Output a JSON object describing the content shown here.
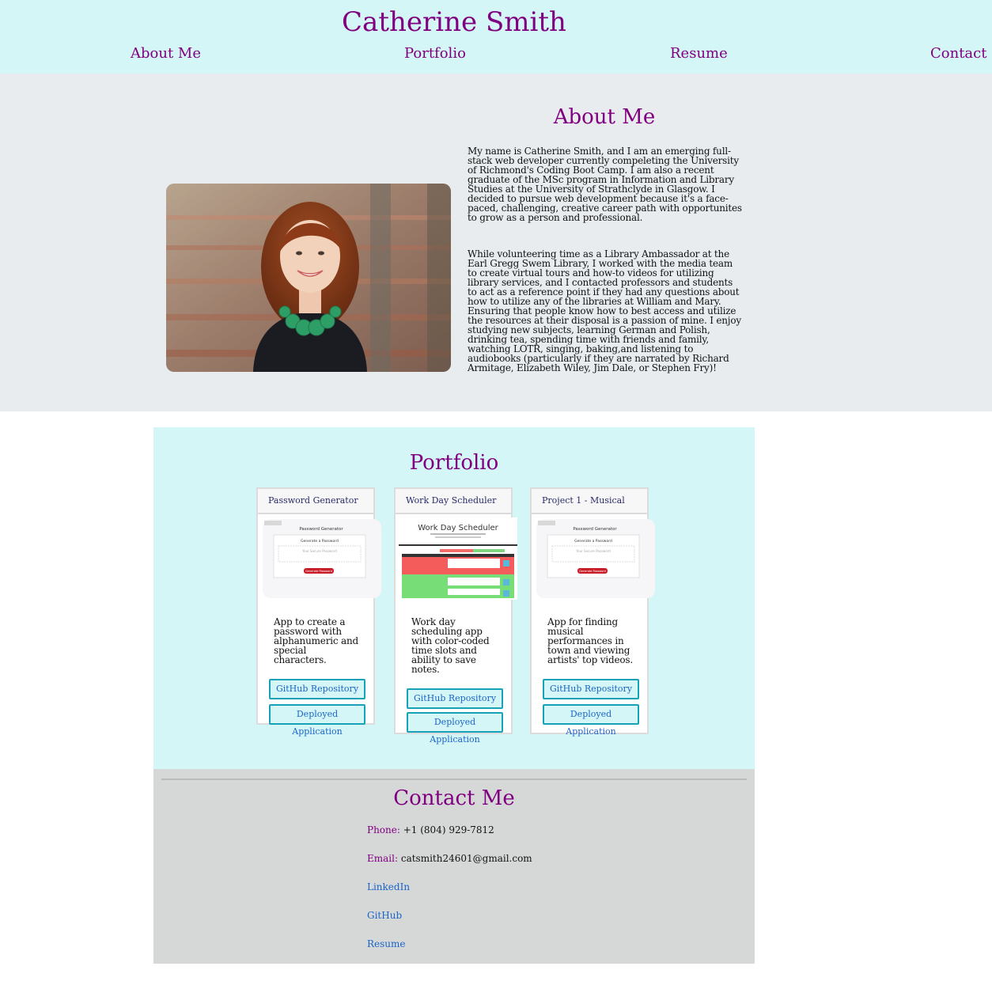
{
  "header": {
    "title": "Catherine Smith",
    "nav": [
      "About Me",
      "Portfolio",
      "Resume",
      "Contact"
    ]
  },
  "about": {
    "title": "About Me",
    "paragraphs": [
      "My name is Catherine Smith, and I am an emerging full-stack web developer currently compeleting the University of Richmond's Coding Boot Camp. I am also a recent graduate of the MSc program in Information and Library Studies at the University of Strathclyde in Glasgow. I decided to pursue web development because it's a face-paced, challenging, creative career path with opportunites to grow as a person and professional.",
      "While volunteering time as a Library Ambassador at the Earl Gregg Swem Library, I worked with the media team to create virtual tours and how-to videos for utilizing library services, and I contacted professors and students to act as a reference point if they had any questions about how to utilize any of the libraries at William and Mary. Ensuring that people know how to best access and utilize the resources at their disposal is a passion of mine. I enjoy studying new subjects, learning German and Polish, drinking tea, spending time with friends and family, watching LOTR, singing, baking,and listening to audiobooks (particularly if they are narrated by Richard Armitage, Elizabeth Wiley, Jim Dale, or Stephen Fry)!"
    ]
  },
  "portfolio": {
    "title": "Portfolio",
    "cards": [
      {
        "title": "Password Generator",
        "description": "App to create a password with alphanumeric and special characters.",
        "thumb_heading": "Password Generator",
        "thumb_subheading": "Generate a Password",
        "thumb_placeholder": "Your Secure Password",
        "thumb_button": "Generate Password",
        "repo_label": "GitHub Repository",
        "app_label": "Deployed Application"
      },
      {
        "title": "Work Day Scheduler",
        "description": "Work day scheduling app with color-coded time slots and ability to save notes.",
        "thumb_heading": "Work Day Scheduler",
        "repo_label": "GitHub Repository",
        "app_label": "Deployed Application"
      },
      {
        "title": "Project 1 - Musical",
        "description": "App for finding musical performances in town and viewing artists' top videos.",
        "thumb_heading": "Password Generator",
        "thumb_subheading": "Generate a Password",
        "thumb_placeholder": "Your Secure Password",
        "thumb_button": "Generate Password",
        "repo_label": "GitHub Repository",
        "app_label": "Deployed Application"
      }
    ]
  },
  "contact": {
    "title": "Contact Me",
    "phone_label": "Phone:",
    "phone": "+1 (804) 929-7812",
    "email_label": "Email:",
    "email": "catsmith24601@gmail.com",
    "links": [
      "LinkedIn",
      "GitHub",
      "Resume"
    ]
  },
  "colors": {
    "accent": "#800080",
    "header_bg": "#d4f6f7",
    "about_bg": "#e8ecef",
    "contact_bg": "#d6d8d8",
    "button_border": "#17a2b8",
    "link": "#1a64c8"
  }
}
